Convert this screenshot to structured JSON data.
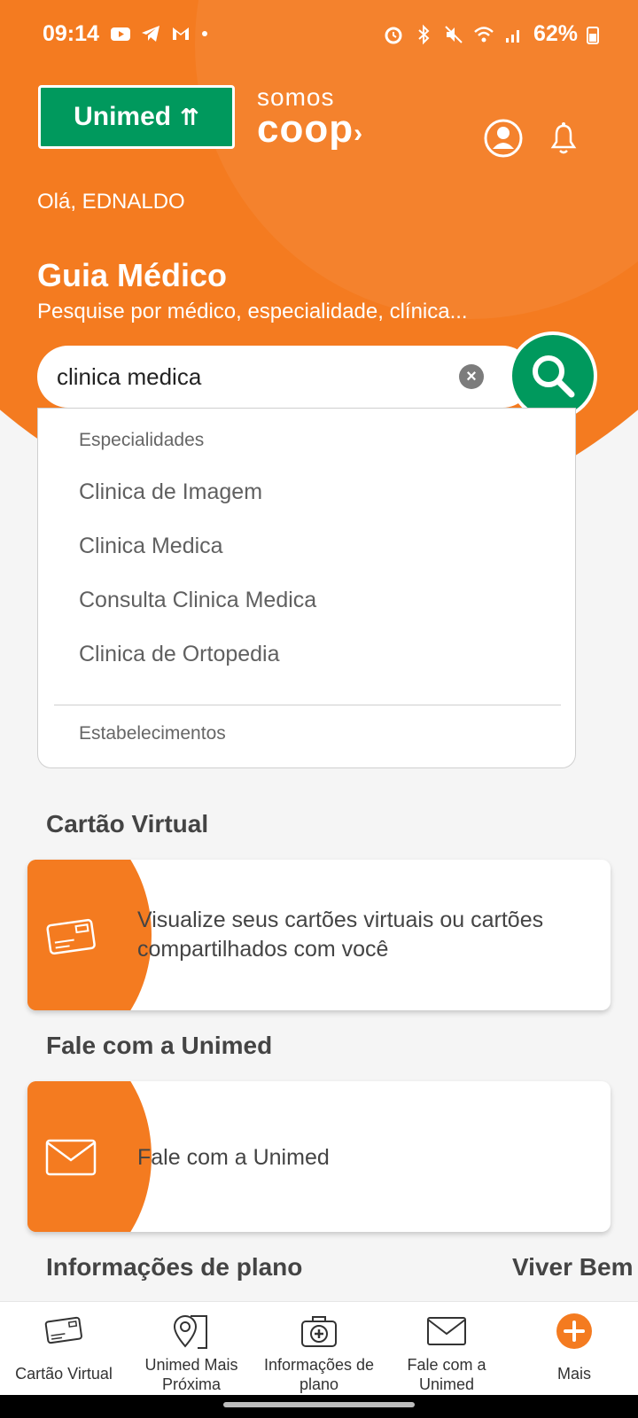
{
  "status_bar": {
    "time": "09:14",
    "battery": "62%"
  },
  "header": {
    "logo_text": "Unimed",
    "coop_top": "somos",
    "coop_bottom": "coop"
  },
  "greeting": "Olá, EDNALDO",
  "guide": {
    "title": "Guia Médico",
    "subtitle": "Pesquise por médico, especialidade, clínica...",
    "search_value": "clinica medica"
  },
  "suggestions": {
    "specialties_heading": "Especialidades",
    "items": [
      "Clinica de Imagem",
      "Clinica Medica",
      "Consulta Clinica Medica",
      "Clinica de Ortopedia"
    ],
    "establishments_heading": "Estabelecimentos"
  },
  "sections": {
    "virtual_card_title": "Cartão Virtual",
    "virtual_card_text": "Visualize seus cartões virtuais ou cartões compartilhados com você",
    "contact_title": "Fale com a Unimed",
    "contact_text": "Fale com a Unimed",
    "plan_info_title": "Informações de plano",
    "live_well_title": "Viver Bem"
  },
  "bottom_nav": [
    {
      "label": "Cartão Virtual",
      "icon": "card-icon"
    },
    {
      "label": "Unimed Mais Próxima",
      "icon": "map-pin-icon"
    },
    {
      "label": "Informações de plano",
      "icon": "medical-kit-icon"
    },
    {
      "label": "Fale com a Unimed",
      "icon": "envelope-icon"
    },
    {
      "label": "Mais",
      "icon": "plus-icon"
    }
  ],
  "colors": {
    "brand_orange": "#f47b20",
    "brand_green": "#00995d"
  }
}
